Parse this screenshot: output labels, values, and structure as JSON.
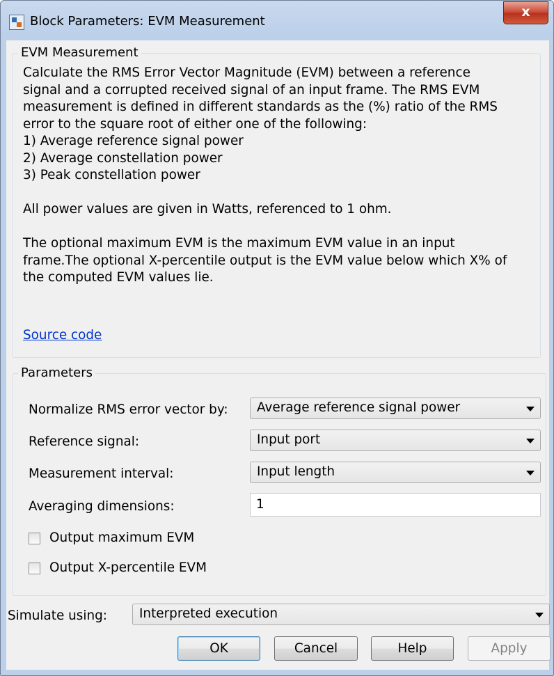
{
  "window": {
    "title": "Block Parameters: EVM Measurement",
    "close_label": "x"
  },
  "description_group": {
    "legend": "EVM Measurement",
    "paragraphs": [
      "Calculate the RMS Error Vector Magnitude (EVM) between a reference\nsignal and a corrupted received signal of an input frame. The RMS EVM\nmeasurement is defined in different standards as the (%) ratio of the RMS\nerror to the square root of either one of the following:\n1) Average reference signal power\n2) Average constellation power\n3) Peak constellation power",
      "All power values are given in Watts, referenced to 1 ohm.",
      "The optional maximum EVM is the maximum EVM value in an input\nframe.The optional X-percentile output is the EVM value below which X% of\nthe computed EVM values lie."
    ],
    "source_link": "Source code"
  },
  "parameters": {
    "legend": "Parameters",
    "normalize": {
      "label": "Normalize RMS error vector by:",
      "value": "Average reference signal power"
    },
    "reference": {
      "label": "Reference signal:",
      "value": "Input port"
    },
    "interval": {
      "label": "Measurement interval:",
      "value": "Input length"
    },
    "averaging": {
      "label": "Averaging dimensions:",
      "value": "1"
    },
    "output_max": {
      "label": "Output maximum EVM",
      "checked": false
    },
    "output_xpct": {
      "label": "Output X-percentile EVM",
      "checked": false
    }
  },
  "simulate": {
    "label": "Simulate using:",
    "value": "Interpreted execution"
  },
  "buttons": {
    "ok": "OK",
    "cancel": "Cancel",
    "help": "Help",
    "apply": "Apply"
  },
  "colors": {
    "link": "#0033cc",
    "close_button": "#c9442f",
    "titlebar": "#c9d9ee"
  },
  "icons": [
    "simulink-block-icon",
    "close-icon",
    "chevron-down-icon",
    "checkbox-icon"
  ]
}
